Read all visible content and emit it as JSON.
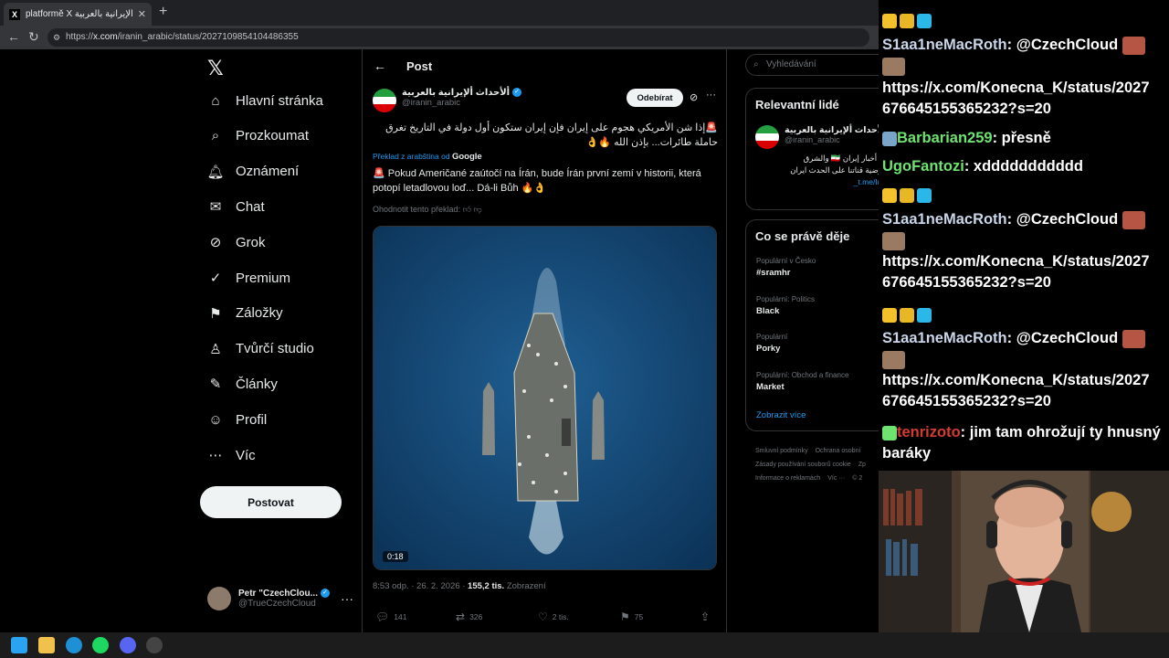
{
  "browser": {
    "tab_title": "platformě X ألأحداث ألإيرانية بالعربية",
    "new_tab": "+",
    "url_prefix": "https://",
    "url_host": "x.com",
    "url_path": "/iranin_arabic/status/2027109854104486355"
  },
  "nav": {
    "items": [
      {
        "label": "Hlavní stránka",
        "icon": "home-icon"
      },
      {
        "label": "Prozkoumat",
        "icon": "search-icon"
      },
      {
        "label": "Oznámení",
        "icon": "bell-icon"
      },
      {
        "label": "Chat",
        "icon": "mail-icon"
      },
      {
        "label": "Grok",
        "icon": "grok-icon"
      },
      {
        "label": "Premium",
        "icon": "premium-icon"
      },
      {
        "label": "Záložky",
        "icon": "bookmark-icon"
      },
      {
        "label": "Tvůrčí studio",
        "icon": "studio-icon"
      },
      {
        "label": "Články",
        "icon": "articles-icon"
      },
      {
        "label": "Profil",
        "icon": "profile-icon"
      },
      {
        "label": "Víc",
        "icon": "more-icon"
      }
    ],
    "post_button": "Postovat",
    "account_name": "Petr \"CzechClou...",
    "account_handle": "@TrueCzechCloud",
    "account_more": "···"
  },
  "post": {
    "header": "Post",
    "author_name": "ألأحداث ألإيرانية بالعربية",
    "author_handle": "@iranin_arabic",
    "follow_label": "Odebírat",
    "text_arabic": "🚨إذا شن الأمريكي هجوم على إيران فإن إيران ستكون أول دولة في التاريخ تغرق حاملة طائرات... بإذن الله 🔥👌",
    "translate_label": "Překlad z arabština od",
    "translate_provider": "Google",
    "text_czech": "🚨 Pokud Američané zaútočí na Írán, bude Írán první zemí v historii, která potopí letadlovou loď... Dá-li Bůh 🔥👌",
    "rate_translation": "Ohodnotit tento překlad:",
    "video_duration": "0:18",
    "timestamp": "8:53 odp. · 26. 2. 2026 · ",
    "views_count": "155,2 tis.",
    "views_label": "Zobrazení",
    "replies": "141",
    "reposts": "326",
    "likes": "2 tis.",
    "bookmarks": "75"
  },
  "sidebar": {
    "search_placeholder": "Vyhledávání",
    "relevant_title": "Relevantní lidé",
    "rel_name": "ألأحداث ألإيرانية بالعربية",
    "rel_handle": "@iranin_arabic",
    "rel_bio": "قل أخبار إيران 🇮🇷 والشرق الأرضية قناتنا على الحدث ايران",
    "rel_link": "t.me/Iran_",
    "trends_title": "Co se právě děje",
    "trends": [
      {
        "category": "Populární v Česko",
        "topic": "#sramhr"
      },
      {
        "category": "Populární: Politics",
        "topic": "Black"
      },
      {
        "category": "Populární",
        "topic": "Porky"
      },
      {
        "category": "Populární: Obchod a finance",
        "topic": "Market"
      }
    ],
    "show_more": "Zobrazit více",
    "footer": [
      "Smluvní podmínky",
      "Ochrana osobní",
      "Zásady používání souborů cookie",
      "Zp",
      "Informace o reklamách",
      "Víc ···",
      "© 2"
    ]
  },
  "chat": {
    "messages": [
      {
        "user": "S1aa1neMacRoth",
        "text": "@CzechCloud",
        "link": "https://x.com/Konecna_K/status/2027676645155365232?s=20"
      },
      {
        "user": "Barbarian259",
        "text": "přesně"
      },
      {
        "user": "UgoFantozi",
        "text": "xddddddddddd"
      },
      {
        "user": "S1aa1neMacRoth",
        "text": "@CzechCloud",
        "link": "https://x.com/Konecna_K/status/2027676645155365232?s=20"
      },
      {
        "user": "S1aa1neMacRoth",
        "text": "@CzechCloud",
        "link": "https://x.com/Konecna_K/status/2027676645155365232?s=20"
      },
      {
        "user": "tenrizoto",
        "text": "jim tam ohrožují ty hnusný baráky"
      }
    ],
    "link_line1": "https://x.com/Konecna_K/status/2027",
    "link_line2": "676645155365232?s=20"
  },
  "colors": {
    "accent": "#1d9bf0",
    "background": "#000000",
    "border": "#2f3336",
    "muted": "#71767b"
  }
}
